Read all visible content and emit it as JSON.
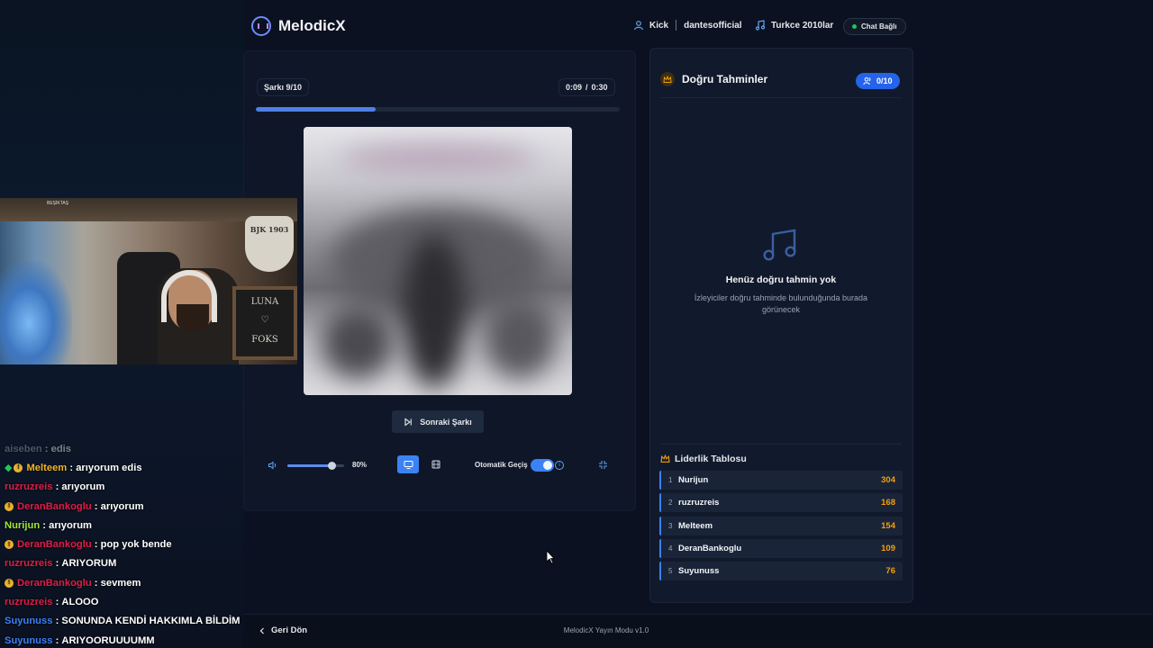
{
  "app": {
    "name": "MelodicX"
  },
  "header": {
    "platform": "Kick",
    "channel": "dantesofficial",
    "playlist": "Turkce 2010lar",
    "chat_status": "Chat Bağlı"
  },
  "player": {
    "song_label": "Şarkı 9/10",
    "time_current": "0:09",
    "time_sep": "/",
    "time_total": "0:30",
    "progress_fraction": 0.33,
    "next_label": "Sonraki Şarkı",
    "volume_percent": "80%",
    "volume_fraction": 0.8,
    "auto_label": "Otomatik Geçiş"
  },
  "guesses": {
    "title": "Doğru Tahminler",
    "count": "0/10",
    "empty_title": "Henüz doğru tahmin yok",
    "empty_sub": "İzleyiciler doğru tahminde bulunduğunda burada görünecek"
  },
  "leaderboard": {
    "title": "Liderlik Tablosu",
    "rows": [
      {
        "rank": "1",
        "name": "Nurijun",
        "score": "304"
      },
      {
        "rank": "2",
        "name": "ruzruzreis",
        "score": "168"
      },
      {
        "rank": "3",
        "name": "Melteem",
        "score": "154"
      },
      {
        "rank": "4",
        "name": "DeranBankoglu",
        "score": "109"
      },
      {
        "rank": "5",
        "name": "Suyunuss",
        "score": "76"
      }
    ]
  },
  "webcam": {
    "crest_text": "BJK 1903",
    "board_line1": "LUNA",
    "board_line2": "♡",
    "board_line3": "FOKS",
    "shelf_text": "BEŞİKTAŞ"
  },
  "chat": [
    {
      "user": "aiseben",
      "text": "edis",
      "color": "#9ca3af",
      "badge": "",
      "faded": true
    },
    {
      "user": "Melteem",
      "text": "arıyorum edis",
      "color": "#f0b429",
      "badge": "gy",
      "faded": false
    },
    {
      "user": "ruzruzreis",
      "text": "arıyorum",
      "color": "#e11d48",
      "badge": "",
      "faded": false
    },
    {
      "user": "DeranBankoglu",
      "text": "arıyorum",
      "color": "#e11d48",
      "badge": "y",
      "faded": false
    },
    {
      "user": "Nurijun",
      "text": "arıyorum",
      "color": "#a3e635",
      "badge": "",
      "faded": false
    },
    {
      "user": "DeranBankoglu",
      "text": "pop yok bende",
      "color": "#e11d48",
      "badge": "y",
      "faded": false
    },
    {
      "user": "ruzruzreis",
      "text": "ARIYORUM",
      "color": "#e11d48",
      "badge": "",
      "faded": false
    },
    {
      "user": "DeranBankoglu",
      "text": "sevmem",
      "color": "#e11d48",
      "badge": "y",
      "faded": false
    },
    {
      "user": "ruzruzreis",
      "text": "ALOOO",
      "color": "#e11d48",
      "badge": "",
      "faded": false
    },
    {
      "user": "Suyunuss",
      "text": "SONUNDA KENDİ HAKKIMLA BİLDİM",
      "color": "#3b82f6",
      "badge": "",
      "faded": false
    },
    {
      "user": "Suyunuss",
      "text": "ARIYOORUUUUMM",
      "color": "#3b82f6",
      "badge": "",
      "faded": false
    }
  ],
  "footer": {
    "back_label": "Geri Dön",
    "version": "MelodicX Yayın Modu v1.0"
  },
  "icons": {
    "logo": "headphones-icon",
    "user": "user-icon",
    "music": "music-note-icon",
    "volume": "volume-icon",
    "monitor": "monitor-icon",
    "film": "film-icon",
    "skip": "skip-forward-icon",
    "crown": "crown-icon",
    "users": "users-icon",
    "back": "chevron-left-icon",
    "collapse": "collapse-icon"
  },
  "colors": {
    "accent": "#3b82f6",
    "gold": "#f59e0b",
    "online": "#22c55e"
  }
}
